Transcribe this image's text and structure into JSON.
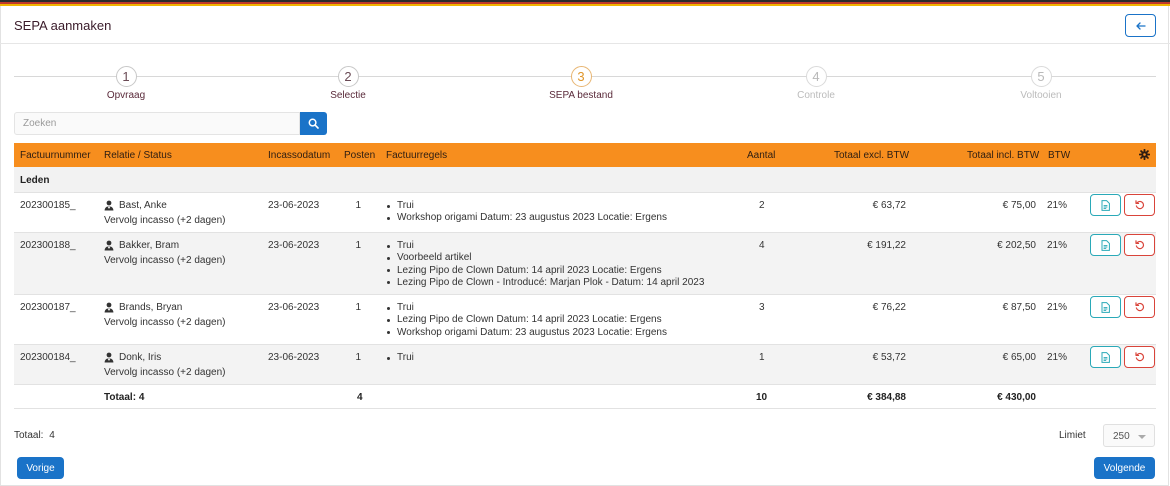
{
  "header": {
    "title": "SEPA aanmaken",
    "back_icon": "arrow-left-icon"
  },
  "stepper": [
    {
      "number": "1",
      "label": "Opvraag",
      "state": "done"
    },
    {
      "number": "2",
      "label": "Selectie",
      "state": "done"
    },
    {
      "number": "3",
      "label": "SEPA bestand",
      "state": "active"
    },
    {
      "number": "4",
      "label": "Controle",
      "state": "todo"
    },
    {
      "number": "5",
      "label": "Voltooien",
      "state": "todo"
    }
  ],
  "search": {
    "placeholder": "Zoeken",
    "value": ""
  },
  "table": {
    "columns": [
      "Factuurnummer",
      "Relatie / Status",
      "Incassodatum",
      "Posten",
      "Factuurregels",
      "Aantal",
      "Totaal excl. BTW",
      "Totaal incl. BTW",
      "BTW"
    ],
    "settings_icon": "gear-icon",
    "group": "Leden",
    "rows": [
      {
        "factuurnummer": "202300185_",
        "relatie": "Bast, Anke",
        "status": "Vervolg incasso (+2 dagen)",
        "incassodatum": "23-06-2023",
        "posten": "1",
        "factuurregels": [
          "Trui",
          "Workshop origami Datum: 23 augustus 2023 Locatie: Ergens"
        ],
        "aantal": "2",
        "excl": "€ 63,72",
        "incl": "€ 75,00",
        "btw": "21%"
      },
      {
        "factuurnummer": "202300188_",
        "relatie": "Bakker, Bram",
        "status": "Vervolg incasso (+2 dagen)",
        "incassodatum": "23-06-2023",
        "posten": "1",
        "factuurregels": [
          "Trui",
          "Voorbeeld artikel",
          "Lezing Pipo de Clown Datum: 14 april 2023 Locatie: Ergens",
          "Lezing Pipo de Clown - Introducé: Marjan Plok - Datum: 14 april 2023"
        ],
        "aantal": "4",
        "excl": "€ 191,22",
        "incl": "€ 202,50",
        "btw": "21%"
      },
      {
        "factuurnummer": "202300187_",
        "relatie": "Brands, Bryan",
        "status": "Vervolg incasso (+2 dagen)",
        "incassodatum": "23-06-2023",
        "posten": "1",
        "factuurregels": [
          "Trui",
          "Lezing Pipo de Clown Datum: 14 april 2023 Locatie: Ergens",
          "Workshop origami Datum: 23 augustus 2023 Locatie: Ergens"
        ],
        "aantal": "3",
        "excl": "€ 76,22",
        "incl": "€ 87,50",
        "btw": "21%"
      },
      {
        "factuurnummer": "202300184_",
        "relatie": "Donk, Iris",
        "status": "Vervolg incasso (+2 dagen)",
        "incassodatum": "23-06-2023",
        "posten": "1",
        "factuurregels": [
          "Trui"
        ],
        "aantal": "1",
        "excl": "€ 53,72",
        "incl": "€ 65,00",
        "btw": "21%"
      }
    ],
    "row_action_icons": [
      "document-icon",
      "undo-icon"
    ],
    "footer": {
      "label": "Totaal: 4",
      "posten": "4",
      "aantal": "10",
      "excl": "€ 384,88",
      "incl": "€ 430,00"
    }
  },
  "bottom": {
    "totaal_label": "Totaal:",
    "totaal_value": "4",
    "limiet_label": "Limiet",
    "limiet_value": "250",
    "prev_label": "Vorige",
    "next_label": "Volgende"
  },
  "colors": {
    "header_orange": "#f78e1e",
    "primary_blue": "#1a73c8",
    "title_maroon": "#3a1b2a",
    "doc_teal": "#2aa9b8",
    "undo_red": "#d9443a"
  }
}
